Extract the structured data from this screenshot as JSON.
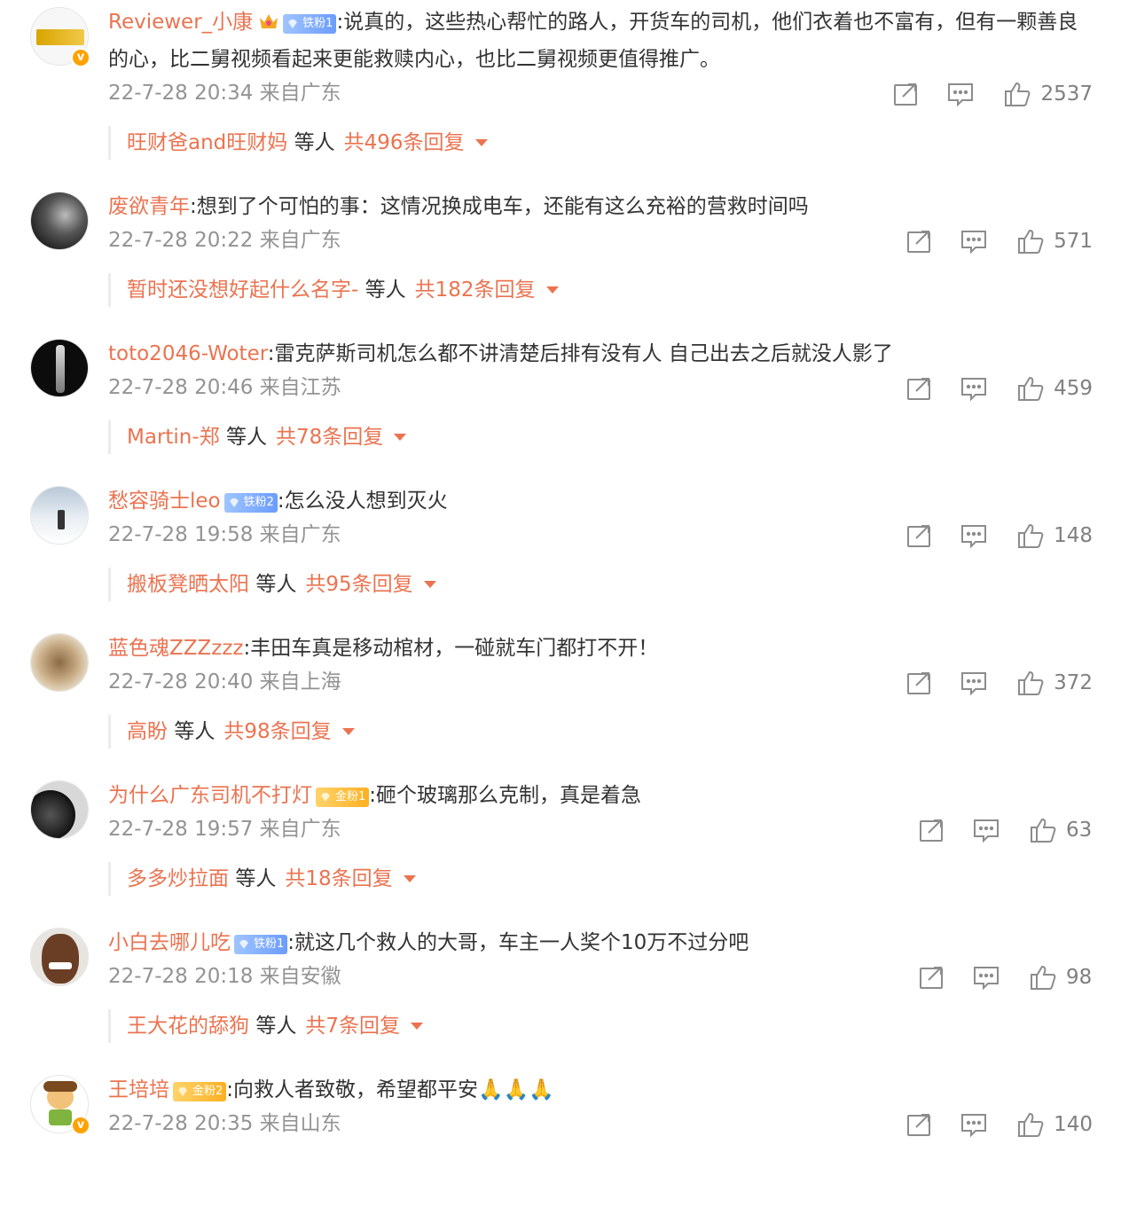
{
  "ui": {
    "accent_color": "#eb7350",
    "meta_color": "#939393",
    "verified_color": "#ffa200",
    "iron_fan_color": "#6b9cff",
    "gold_fan_color": "#ffb020"
  },
  "comments": [
    {
      "user": "Reviewer_小康",
      "crown": true,
      "fan_type": "iron",
      "fan_label": "铁粉1",
      "verified": true,
      "text": ":说真的，这些热心帮忙的路人，开货车的司机，他们衣着也不富有，但有一颗善良的心，比二舅视频看起来更能救赎内心，也比二舅视频更值得推广。",
      "time": "22-7-28 20:34 来自广东",
      "likes": "2537",
      "reply_user": "旺财爸and旺财妈",
      "reply_mid": "等人",
      "reply_total": "共496条回复",
      "avatar": "gold-banner"
    },
    {
      "user": "废欲青年",
      "crown": false,
      "fan_type": "",
      "fan_label": "",
      "verified": false,
      "text": ":想到了个可怕的事：这情况换成电车，还能有这么充裕的营救时间吗",
      "time": "22-7-28 20:22 来自广东",
      "likes": "571",
      "reply_user": "暂时还没想好起什么名字-",
      "reply_mid": "等人",
      "reply_total": "共182条回复",
      "avatar": "dark-portrait"
    },
    {
      "user": "toto2046-Woter",
      "crown": false,
      "fan_type": "",
      "fan_label": "",
      "verified": false,
      "text": ":雷克萨斯司机怎么都不讲清楚后排有没有人 自己出去之后就没人影了",
      "time": "22-7-28 20:46 来自江苏",
      "likes": "459",
      "reply_user": "Martin-郑",
      "reply_mid": "等人",
      "reply_total": "共78条回复",
      "avatar": "dark-figure"
    },
    {
      "user": "愁容骑士leo",
      "crown": false,
      "fan_type": "iron",
      "fan_label": "铁粉2",
      "verified": false,
      "text": ":怎么没人想到灭火",
      "time": "22-7-28 19:58 来自广东",
      "likes": "148",
      "reply_user": "搬板凳晒太阳",
      "reply_mid": "等人",
      "reply_total": "共95条回复",
      "avatar": "snow-dog"
    },
    {
      "user": "蓝色魂ZZZzzz",
      "crown": false,
      "fan_type": "",
      "fan_label": "",
      "verified": false,
      "text": ":丰田车真是移动棺材，一碰就车门都打不开！",
      "time": "22-7-28 20:40 来自上海",
      "likes": "372",
      "reply_user": "高盼",
      "reply_mid": "等人",
      "reply_total": "共98条回复",
      "avatar": "brown-sculpture"
    },
    {
      "user": "为什么广东司机不打灯",
      "crown": false,
      "fan_type": "gold",
      "fan_label": "金粉1",
      "verified": false,
      "text": ":砸个玻璃那么克制，真是着急",
      "time": "22-7-28 19:57 来自广东",
      "likes": "63",
      "reply_user": "多多炒拉面",
      "reply_mid": "等人",
      "reply_total": "共18条回复",
      "avatar": "car-wheel"
    },
    {
      "user": "小白去哪儿吃",
      "crown": false,
      "fan_type": "iron",
      "fan_label": "铁粉1",
      "verified": false,
      "text": ":就这几个救人的大哥，车主一人奖个10万不过分吧",
      "time": "22-7-28 20:18 来自安徽",
      "likes": "98",
      "reply_user": "王大花的舔狗",
      "reply_mid": "等人",
      "reply_total": "共7条回复",
      "avatar": "smiling-man"
    },
    {
      "user": "王培培",
      "crown": false,
      "fan_type": "gold",
      "fan_label": "金粉2",
      "verified": true,
      "text": ":向救人者致敬，希望都平安🙏🙏🙏",
      "time": "22-7-28 20:35 来自山东",
      "likes": "140",
      "reply_user": "",
      "reply_mid": "",
      "reply_total": "",
      "avatar": "cartoon-boy"
    }
  ]
}
